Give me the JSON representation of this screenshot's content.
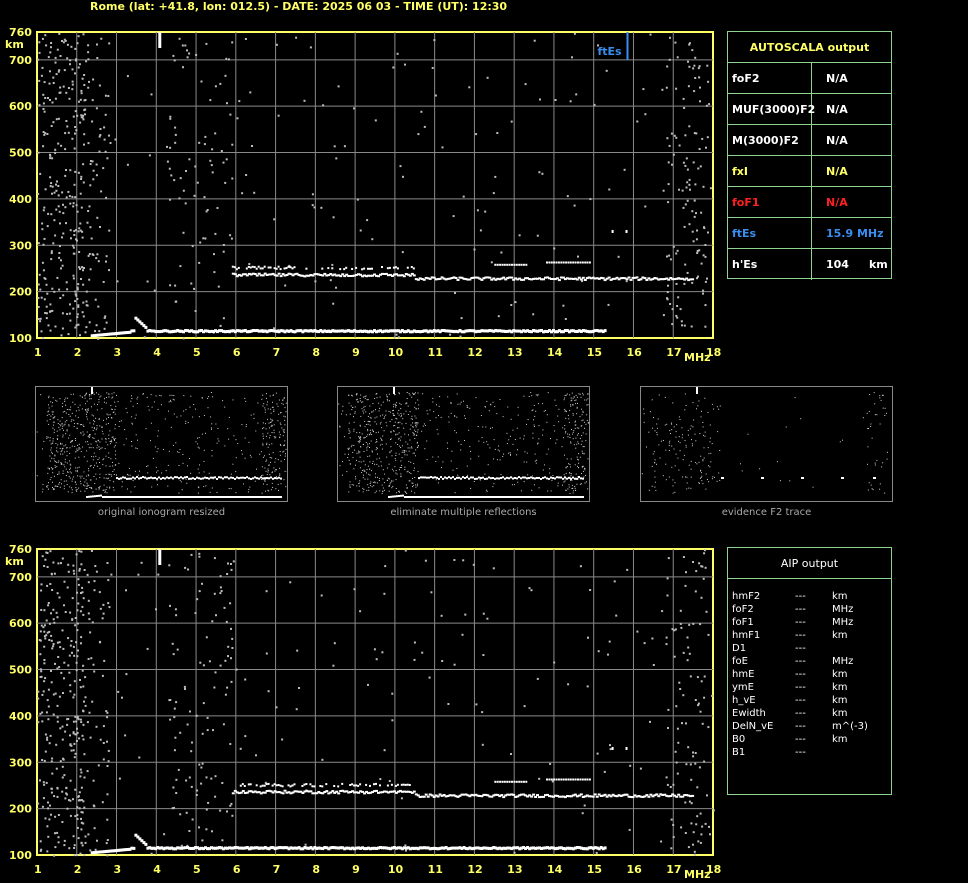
{
  "header": "Rome (lat: +41.8, lon: 012.5) - DATE: 2025 06 03 - TIME (UT): 12:30",
  "axes": {
    "y_ticks": [
      "760",
      "700",
      "600",
      "500",
      "400",
      "300",
      "200",
      "100"
    ],
    "y_unit": "km",
    "x_ticks": [
      "1",
      "2",
      "3",
      "4",
      "5",
      "6",
      "7",
      "8",
      "9",
      "10",
      "11",
      "12",
      "13",
      "14",
      "15",
      "16",
      "17",
      "18"
    ],
    "x_unit": "MHz"
  },
  "fte_label": "ftEs",
  "autoscala": {
    "title": "AUTOSCALA output",
    "rows": [
      {
        "name": "foF2",
        "value": "N/A",
        "unit": "",
        "color": "#ffffff"
      },
      {
        "name": "MUF(3000)F2",
        "value": "N/A",
        "unit": "",
        "color": "#ffffff"
      },
      {
        "name": "M(3000)F2",
        "value": "N/A",
        "unit": "",
        "color": "#ffffff"
      },
      {
        "name": "fxI",
        "value": "N/A",
        "unit": "",
        "color": "#ffff66"
      },
      {
        "name": "foF1",
        "value": "N/A",
        "unit": "",
        "color": "#ff2020"
      },
      {
        "name": "ftEs",
        "value": "15.9 MHz",
        "unit": "",
        "color": "#3a8ef0"
      },
      {
        "name": "h'Es",
        "value": "104",
        "unit": "km",
        "color": "#ffffff"
      }
    ]
  },
  "aip": {
    "title": "AIP output",
    "rows": [
      {
        "name": "hmF2",
        "value": "---",
        "unit": "km"
      },
      {
        "name": "foF2",
        "value": "---",
        "unit": "MHz"
      },
      {
        "name": "foF1",
        "value": "---",
        "unit": "MHz"
      },
      {
        "name": "hmF1",
        "value": "---",
        "unit": "km"
      },
      {
        "name": "D1",
        "value": "---",
        "unit": ""
      },
      {
        "name": "foE",
        "value": "---",
        "unit": "MHz"
      },
      {
        "name": "hmE",
        "value": "---",
        "unit": "km"
      },
      {
        "name": "ymE",
        "value": "---",
        "unit": "km"
      },
      {
        "name": "h_vE",
        "value": "---",
        "unit": "km"
      },
      {
        "name": "Ewidth",
        "value": "---",
        "unit": "km"
      },
      {
        "name": "DelN_vE",
        "value": "---",
        "unit": "m^(-3)"
      },
      {
        "name": "B0",
        "value": "---",
        "unit": "km"
      },
      {
        "name": "B1",
        "value": "---",
        "unit": ""
      }
    ]
  },
  "thumbnails": [
    {
      "caption": "original ionogram resized"
    },
    {
      "caption": "eliminate multiple reflections"
    },
    {
      "caption": "evidence F2 trace"
    }
  ],
  "colors": {
    "axis": "#ffff66",
    "grid": "#8a8a8a",
    "table_border": "#8fd58f",
    "ftes": "#3a8ef0"
  }
}
